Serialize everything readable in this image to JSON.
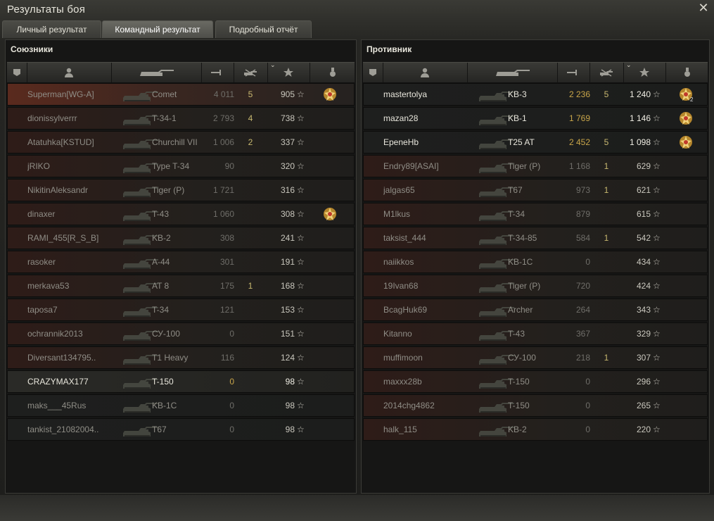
{
  "window": {
    "title": "Результаты боя"
  },
  "tabs": [
    {
      "label": "Личный результат",
      "active": false
    },
    {
      "label": "Командный результат",
      "active": true
    },
    {
      "label": "Подробный отчёт",
      "active": false
    }
  ],
  "allies": {
    "title": "Союзники",
    "rows": [
      {
        "name": "Superman[WG-A]",
        "tank": "Comet",
        "damage": "4 011",
        "kills": "5",
        "xp": "905",
        "medal": true,
        "style": "hl"
      },
      {
        "name": "dionissylverrr",
        "tank": "T-34-1",
        "damage": "2 793",
        "kills": "4",
        "xp": "738",
        "medal": false,
        "style": ""
      },
      {
        "name": "Atatuhka[KSTUD]",
        "tank": "Churchill VII",
        "damage": "1 006",
        "kills": "2",
        "xp": "337",
        "medal": false,
        "style": ""
      },
      {
        "name": "jRIKO",
        "tank": "Type T-34",
        "damage": "90",
        "kills": "",
        "xp": "320",
        "medal": false,
        "style": ""
      },
      {
        "name": "NikitinAleksandr",
        "tank": "Tiger (P)",
        "damage": "1 721",
        "kills": "",
        "xp": "316",
        "medal": false,
        "style": ""
      },
      {
        "name": "dinaxer",
        "tank": "T-43",
        "damage": "1 060",
        "kills": "",
        "xp": "308",
        "medal": true,
        "style": ""
      },
      {
        "name": "RAMI_455[R_S_B]",
        "tank": "KB-2",
        "damage": "308",
        "kills": "",
        "xp": "241",
        "medal": false,
        "style": ""
      },
      {
        "name": "rasoker",
        "tank": "A-44",
        "damage": "301",
        "kills": "",
        "xp": "191",
        "medal": false,
        "style": ""
      },
      {
        "name": "merkava53",
        "tank": "AT 8",
        "damage": "175",
        "kills": "1",
        "xp": "168",
        "medal": false,
        "style": ""
      },
      {
        "name": "taposa7",
        "tank": "T-34",
        "damage": "121",
        "kills": "",
        "xp": "153",
        "medal": false,
        "style": ""
      },
      {
        "name": "ochrannik2013",
        "tank": "СУ-100",
        "damage": "0",
        "kills": "",
        "xp": "151",
        "medal": false,
        "style": ""
      },
      {
        "name": "Diversant134795..",
        "tank": "T1 Heavy",
        "damage": "116",
        "kills": "",
        "xp": "124",
        "medal": false,
        "style": ""
      },
      {
        "name": "CRAZYMAX177",
        "tank": "T-150",
        "damage": "0",
        "kills": "",
        "xp": "98",
        "medal": false,
        "style": "me"
      },
      {
        "name": "maks___45Rus",
        "tank": "KB-1C",
        "damage": "0",
        "kills": "",
        "xp": "98",
        "medal": false,
        "style": "dark"
      },
      {
        "name": "tankist_21082004..",
        "tank": "T67",
        "damage": "0",
        "kills": "",
        "xp": "98",
        "medal": false,
        "style": "dark"
      }
    ]
  },
  "enemies": {
    "title": "Противник",
    "rows": [
      {
        "name": "mastertolya",
        "tank": "KB-3",
        "damage": "2 236",
        "kills": "5",
        "xp": "1 240",
        "medal": true,
        "medal_count": "2",
        "style": "dark-bright"
      },
      {
        "name": "mazan28",
        "tank": "KB-1",
        "damage": "1 769",
        "kills": "",
        "xp": "1 146",
        "medal": true,
        "medal_count": "",
        "style": "dark-bright"
      },
      {
        "name": "EpeneHb",
        "tank": "T25 AT",
        "damage": "2 452",
        "kills": "5",
        "xp": "1 098",
        "medal": true,
        "medal_count": "",
        "style": "dark-bright"
      },
      {
        "name": "Endry89[ASAI]",
        "tank": "Tiger (P)",
        "damage": "1 168",
        "kills": "1",
        "xp": "629",
        "medal": false,
        "style": ""
      },
      {
        "name": "jalgas65",
        "tank": "T67",
        "damage": "973",
        "kills": "1",
        "xp": "621",
        "medal": false,
        "style": ""
      },
      {
        "name": "M1lkus",
        "tank": "T-34",
        "damage": "879",
        "kills": "",
        "xp": "615",
        "medal": false,
        "style": ""
      },
      {
        "name": "taksist_444",
        "tank": "T-34-85",
        "damage": "584",
        "kills": "1",
        "xp": "542",
        "medal": false,
        "style": ""
      },
      {
        "name": "naiikkos",
        "tank": "KB-1C",
        "damage": "0",
        "kills": "",
        "xp": "434",
        "medal": false,
        "style": ""
      },
      {
        "name": "19Ivan68",
        "tank": "Tiger (P)",
        "damage": "720",
        "kills": "",
        "xp": "424",
        "medal": false,
        "style": ""
      },
      {
        "name": "BcagHuk69",
        "tank": "Archer",
        "damage": "264",
        "kills": "",
        "xp": "343",
        "medal": false,
        "style": ""
      },
      {
        "name": "Kitanno",
        "tank": "T-43",
        "damage": "367",
        "kills": "",
        "xp": "329",
        "medal": false,
        "style": ""
      },
      {
        "name": "muffimoon",
        "tank": "СУ-100",
        "damage": "218",
        "kills": "1",
        "xp": "307",
        "medal": false,
        "style": ""
      },
      {
        "name": "maxxx28b",
        "tank": "T-150",
        "damage": "0",
        "kills": "",
        "xp": "296",
        "medal": false,
        "style": ""
      },
      {
        "name": "2014chg4862",
        "tank": "T-150",
        "damage": "0",
        "kills": "",
        "xp": "265",
        "medal": false,
        "style": ""
      },
      {
        "name": "halk_115",
        "tank": "KB-2",
        "damage": "0",
        "kills": "",
        "xp": "220",
        "medal": false,
        "style": ""
      }
    ]
  },
  "icons": {
    "close": "close-icon",
    "columns": [
      "squad-icon",
      "player-icon",
      "tank-icon",
      "damage-icon",
      "kills-icon",
      "xp-star-icon",
      "medal-icon"
    ]
  },
  "colors": {
    "accent": "#c9a64a",
    "allies_row": "#2e1c18",
    "highlight_row": "#5a2a1e"
  }
}
